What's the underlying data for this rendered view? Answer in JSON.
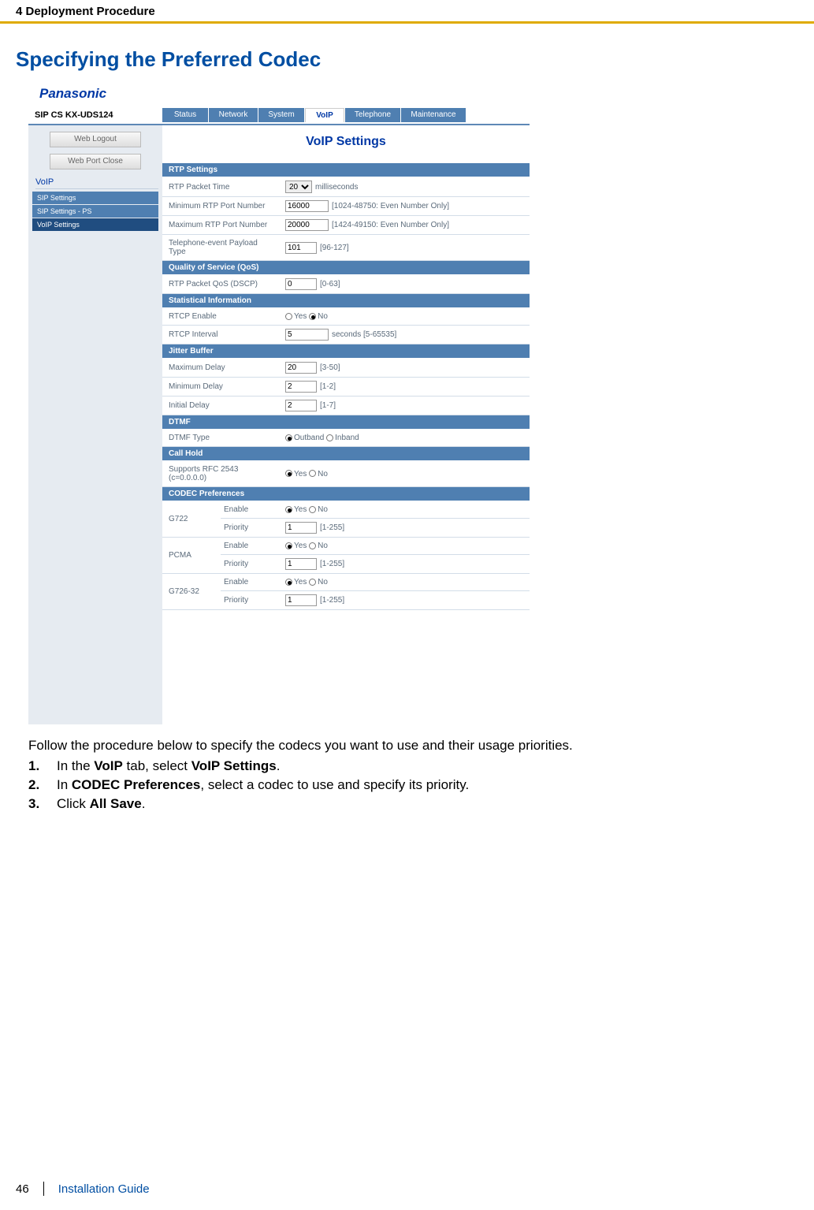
{
  "header": {
    "chapter": "4 Deployment Procedure",
    "section_title": "Specifying the Preferred Codec"
  },
  "screenshot": {
    "brand": "Panasonic",
    "product": "SIP CS KX-UDS124",
    "tabs": [
      "Status",
      "Network",
      "System",
      "VoIP",
      "Telephone",
      "Maintenance"
    ],
    "active_tab": "VoIP",
    "sidebar": {
      "buttons": [
        "Web Logout",
        "Web Port Close"
      ],
      "heading": "VoIP",
      "items": [
        "SIP Settings",
        "SIP Settings - PS",
        "VoIP Settings"
      ],
      "active_item": "VoIP Settings"
    },
    "content_title": "VoIP Settings",
    "sections": {
      "rtp": {
        "title": "RTP Settings",
        "rows": {
          "packet_time": {
            "label": "RTP Packet Time",
            "value": "20",
            "hint": "milliseconds"
          },
          "min_port": {
            "label": "Minimum RTP Port Number",
            "value": "16000",
            "hint": "[1024-48750: Even Number Only]"
          },
          "max_port": {
            "label": "Maximum RTP Port Number",
            "value": "20000",
            "hint": "[1424-49150: Even Number Only]"
          },
          "payload": {
            "label": "Telephone-event Payload Type",
            "value": "101",
            "hint": "[96-127]"
          }
        }
      },
      "qos": {
        "title": "Quality of Service (QoS)",
        "dscp": {
          "label": "RTP Packet QoS (DSCP)",
          "value": "0",
          "hint": "[0-63]"
        }
      },
      "stats": {
        "title": "Statistical Information",
        "rtcp_en": {
          "label": "RTCP Enable",
          "yes": "Yes",
          "no": "No"
        },
        "rtcp_int": {
          "label": "RTCP Interval",
          "value": "5",
          "hint": "seconds [5-65535]"
        }
      },
      "jitter": {
        "title": "Jitter Buffer",
        "max": {
          "label": "Maximum Delay",
          "value": "20",
          "hint": "[3-50]"
        },
        "min": {
          "label": "Minimum Delay",
          "value": "2",
          "hint": "[1-2]"
        },
        "init": {
          "label": "Initial Delay",
          "value": "2",
          "hint": "[1-7]"
        }
      },
      "dtmf": {
        "title": "DTMF",
        "type": {
          "label": "DTMF Type",
          "out": "Outband",
          "in": "Inband"
        }
      },
      "hold": {
        "title": "Call Hold",
        "rfc": {
          "label": "Supports RFC 2543 (c=0.0.0.0)",
          "yes": "Yes",
          "no": "No"
        }
      },
      "codec": {
        "title": "CODEC Preferences",
        "enable": "Enable",
        "priority": "Priority",
        "yes": "Yes",
        "no": "No",
        "hint": "[1-255]",
        "g722": {
          "name": "G722",
          "pri": "1"
        },
        "pcma": {
          "name": "PCMA",
          "pri": "1"
        },
        "g726": {
          "name": "G726-32",
          "pri": "1"
        }
      }
    }
  },
  "body": {
    "intro": "Follow the procedure below to specify the codecs you want to use and their usage priorities.",
    "steps": {
      "s1": {
        "pre": "In the ",
        "b1": "VoIP",
        "mid": " tab, select ",
        "b2": "VoIP Settings",
        "post": "."
      },
      "s2": {
        "pre": "In ",
        "b1": "CODEC Preferences",
        "post": ", select a codec to use and specify its priority."
      },
      "s3": {
        "pre": "Click ",
        "b1": "All Save",
        "post": "."
      }
    }
  },
  "footer": {
    "page": "46",
    "doc": "Installation Guide"
  }
}
